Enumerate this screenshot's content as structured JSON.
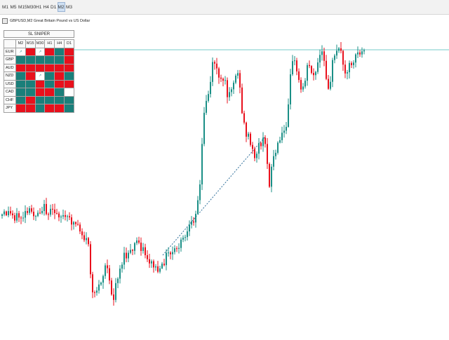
{
  "toolbar": {
    "timeframes": [
      {
        "label": "M1",
        "active": false
      },
      {
        "label": "M5",
        "active": false
      },
      {
        "label": "M15",
        "active": false
      },
      {
        "label": "M30",
        "active": false
      },
      {
        "label": "H1",
        "active": false
      },
      {
        "label": "H4",
        "active": false
      },
      {
        "label": "D1",
        "active": false
      },
      {
        "label": "M2",
        "active": true
      },
      {
        "label": "M3",
        "active": false
      }
    ]
  },
  "chart": {
    "title": "GBPUSD,M2 Great Britain Pound vs US Dollar",
    "colors": {
      "bull": "#1a8f86",
      "bear": "#e8101c",
      "level_line": "#74cbc8",
      "trend_line": "#2f6f9a",
      "background": "#ffffff"
    }
  },
  "panel": {
    "title": "SL SNIPER",
    "columns": [
      "M2",
      "M15",
      "M30",
      "H1",
      "H4",
      "D1"
    ],
    "rows": [
      {
        "pair": "EUR",
        "cells": [
          "blank",
          "red",
          "blank",
          "red",
          "teal",
          "red"
        ]
      },
      {
        "pair": "GBP",
        "cells": [
          "teal",
          "teal",
          "teal",
          "teal",
          "teal",
          "red"
        ]
      },
      {
        "pair": "AUD",
        "cells": [
          "red",
          "red",
          "red",
          "red",
          "red",
          "red"
        ]
      },
      {
        "pair": "NZD",
        "cells": [
          "teal",
          "red",
          "blank",
          "teal",
          "red",
          "teal"
        ]
      },
      {
        "pair": "USD",
        "cells": [
          "teal",
          "teal",
          "red",
          "teal",
          "red",
          "red"
        ]
      },
      {
        "pair": "CAD",
        "cells": [
          "teal",
          "teal",
          "red",
          "red",
          "teal",
          "white"
        ]
      },
      {
        "pair": "CHF",
        "cells": [
          "teal",
          "red",
          "teal",
          "teal",
          "teal",
          "teal"
        ]
      },
      {
        "pair": "JPY",
        "cells": [
          "red",
          "red",
          "teal",
          "red",
          "red",
          "teal"
        ]
      }
    ]
  }
}
